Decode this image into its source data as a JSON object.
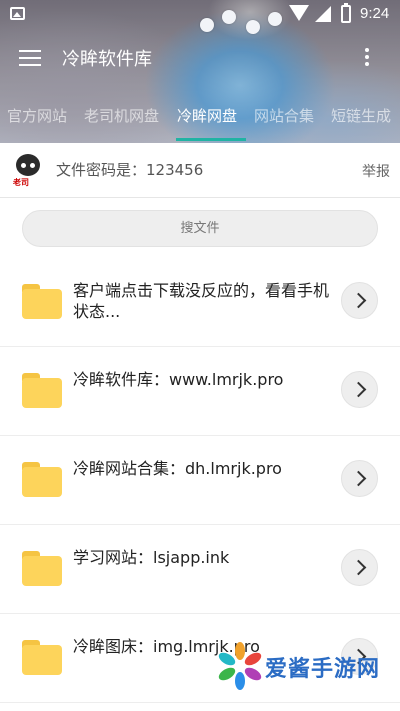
{
  "status_bar": {
    "time": "9:24"
  },
  "app_bar": {
    "title": "冷眸软件库"
  },
  "tabs": [
    {
      "label": "官方网站",
      "active": false
    },
    {
      "label": "老司机网盘",
      "active": false
    },
    {
      "label": "冷眸网盘",
      "active": true
    },
    {
      "label": "网站合集",
      "active": false
    },
    {
      "label": "短链生成",
      "active": false
    }
  ],
  "info": {
    "password_text": "文件密码是：123456",
    "report_label": "举报",
    "avatar_caption": "老司"
  },
  "search": {
    "placeholder": "搜文件"
  },
  "files": [
    {
      "title": "客户端点击下载没反应的，看看手机状态..."
    },
    {
      "title": "冷眸软件库：www.lmrjk.pro"
    },
    {
      "title": "冷眸网站合集：dh.lmrjk.pro"
    },
    {
      "title": "学习网站：lsjapp.ink"
    },
    {
      "title": "冷眸图床：img.lmrjk.pro"
    }
  ],
  "watermark": {
    "text": "爱酱手游网"
  },
  "colors": {
    "tab_indicator": "#20b3a4",
    "folder": "#fdd45b",
    "watermark": "#2b6cc4"
  }
}
